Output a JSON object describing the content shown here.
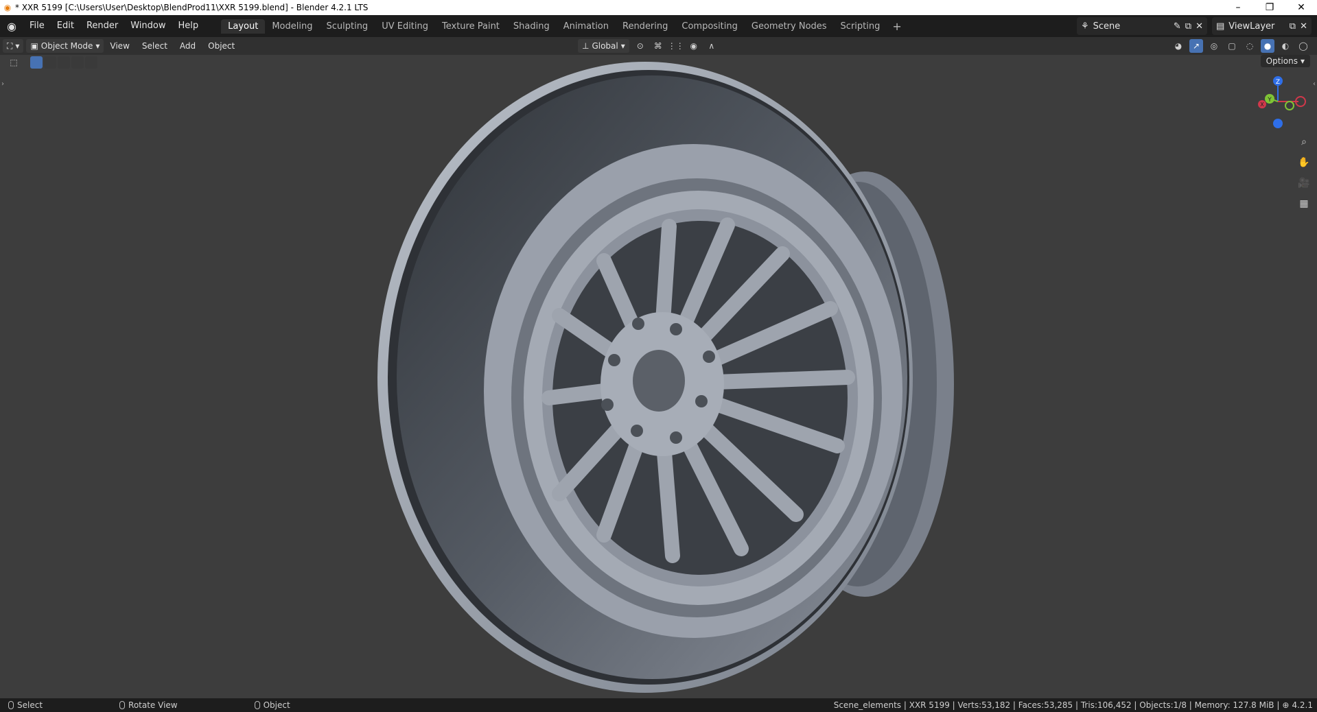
{
  "window": {
    "title": "* XXR 5199 [C:\\Users\\User\\Desktop\\BlendProd11\\XXR 5199.blend] - Blender 4.2.1 LTS",
    "controls": [
      "–",
      "❐",
      "✕"
    ]
  },
  "menu": [
    "File",
    "Edit",
    "Render",
    "Window",
    "Help"
  ],
  "workspaces": {
    "active": "Layout",
    "tabs": [
      "Layout",
      "Modeling",
      "Sculpting",
      "UV Editing",
      "Texture Paint",
      "Shading",
      "Animation",
      "Rendering",
      "Compositing",
      "Geometry Nodes",
      "Scripting"
    ],
    "add": "+"
  },
  "scene": {
    "name": "Scene",
    "view_layer": "ViewLayer"
  },
  "viewport_header": {
    "mode": "Object Mode",
    "menus": [
      "View",
      "Select",
      "Add",
      "Object"
    ],
    "transform_orientation": "Global"
  },
  "options_label": "Options",
  "gizmo_axes": {
    "z": "Z",
    "y": "Y",
    "x": "X"
  },
  "colors": {
    "accent": "#4772b3",
    "axis_x": "#d1384b",
    "axis_y": "#7fc435",
    "axis_z": "#2e6ee8",
    "wheel": "#8c93a0"
  },
  "statusbar": {
    "left": [
      "Select",
      "Rotate View",
      "Object"
    ],
    "stats": "Scene_elements | XXR 5199 | Verts:53,182 | Faces:53,285 | Tris:106,452 | Objects:1/8 | Memory: 127.8 MiB |",
    "version": "4.2.1"
  }
}
